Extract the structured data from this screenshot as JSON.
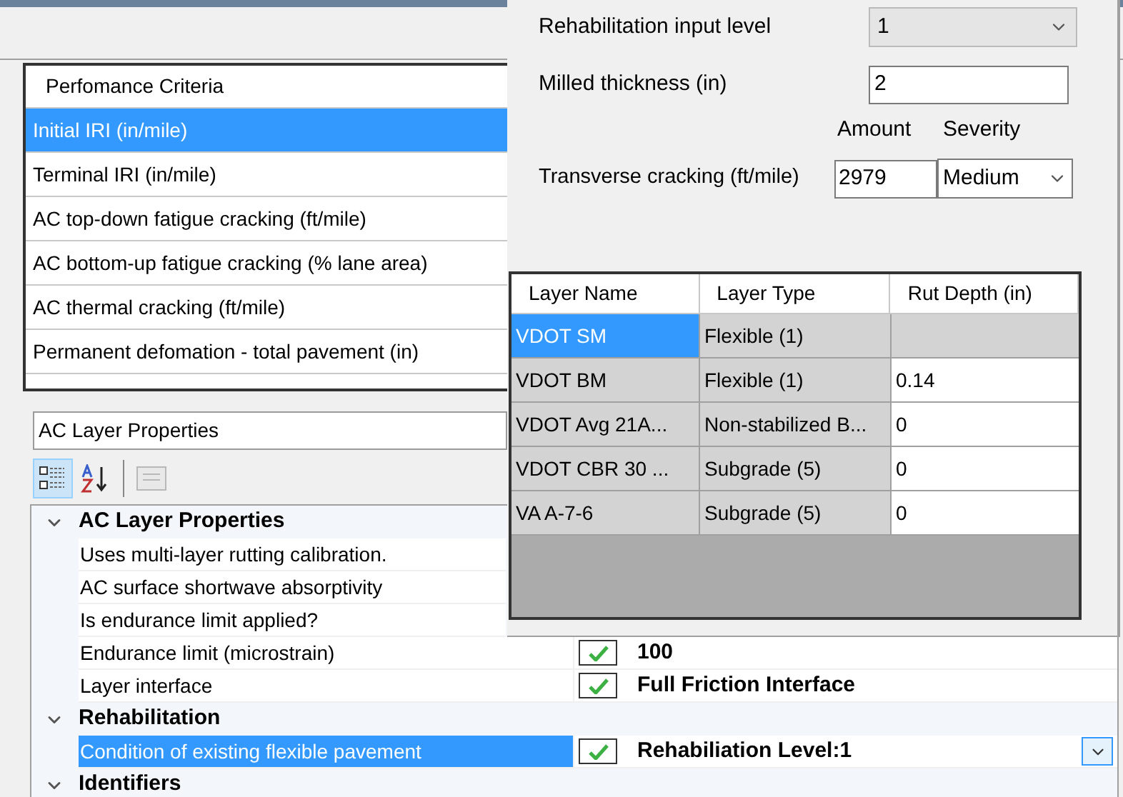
{
  "criteria_list": {
    "header": "Perfomance Criteria",
    "items": [
      {
        "label": "Initial IRI  (in/mile)",
        "selected": true
      },
      {
        "label": "Terminal IRI (in/mile)",
        "selected": false
      },
      {
        "label": "AC top-down fatigue cracking (ft/mile)",
        "selected": false
      },
      {
        "label": "AC bottom-up fatigue cracking (% lane area)",
        "selected": false
      },
      {
        "label": "AC thermal cracking (ft/mile)",
        "selected": false
      },
      {
        "label": "Permanent defomation - total pavement (in)",
        "selected": false
      }
    ]
  },
  "property_selector": {
    "value": "AC Layer Properties"
  },
  "toolbar": [
    {
      "kind": "categorized",
      "selected": true,
      "disabled": false
    },
    {
      "kind": "alphabetical",
      "selected": false,
      "disabled": false
    },
    {
      "kind": "property_pages",
      "selected": false,
      "disabled": true
    }
  ],
  "property_grid": {
    "categories": [
      {
        "label": "AC Layer Properties",
        "expanded": true,
        "properties": [
          {
            "label": "Uses multi-layer rutting calibration.",
            "selected": false
          },
          {
            "label": "AC surface shortwave absorptivity",
            "selected": false
          },
          {
            "label": "Is endurance limit applied?",
            "selected": false
          },
          {
            "label": "Endurance limit (microstrain)",
            "selected": false,
            "checked": true,
            "value": "100",
            "kind": "text"
          },
          {
            "label": "Layer interface",
            "selected": false,
            "checked": true,
            "value": "Full Friction Interface",
            "kind": "text"
          }
        ]
      },
      {
        "label": "Rehabilitation",
        "expanded": true,
        "properties": [
          {
            "label": "Condition of existing flexible pavement",
            "selected": true,
            "checked": true,
            "value": "Rehabiliation Level:1",
            "kind": "dropdown"
          }
        ]
      },
      {
        "label": "Identifiers",
        "expanded": true
      }
    ]
  },
  "rehab_panel": {
    "input_level": {
      "label": "Rehabilitation input level",
      "value": "1"
    },
    "milled_thickness": {
      "label": "Milled thickness (in)",
      "value": "2"
    },
    "amount_header": "Amount",
    "severity_header": "Severity",
    "transverse_cracking": {
      "label": "Transverse cracking (ft/mile)",
      "amount": "2979",
      "severity": "Medium"
    },
    "layers": {
      "columns": [
        "Layer Name",
        "Layer Type",
        "Rut Depth (in)"
      ],
      "rows": [
        {
          "name": "VDOT SM",
          "type": "Flexible (1)",
          "selected": true
        },
        {
          "name": "VDOT BM",
          "type": "Flexible (1)",
          "rut_depth": "0.14",
          "selected": false
        },
        {
          "name": "VDOT Avg 21A...",
          "type": "Non-stabilized B...",
          "rut_depth": "0",
          "selected": false
        },
        {
          "name": "VDOT CBR 30 ...",
          "type": "Subgrade (5)",
          "rut_depth": "0",
          "selected": false
        },
        {
          "name": "VA A-7-6",
          "type": "Subgrade (5)",
          "rut_depth": "0",
          "selected": false
        }
      ]
    }
  }
}
